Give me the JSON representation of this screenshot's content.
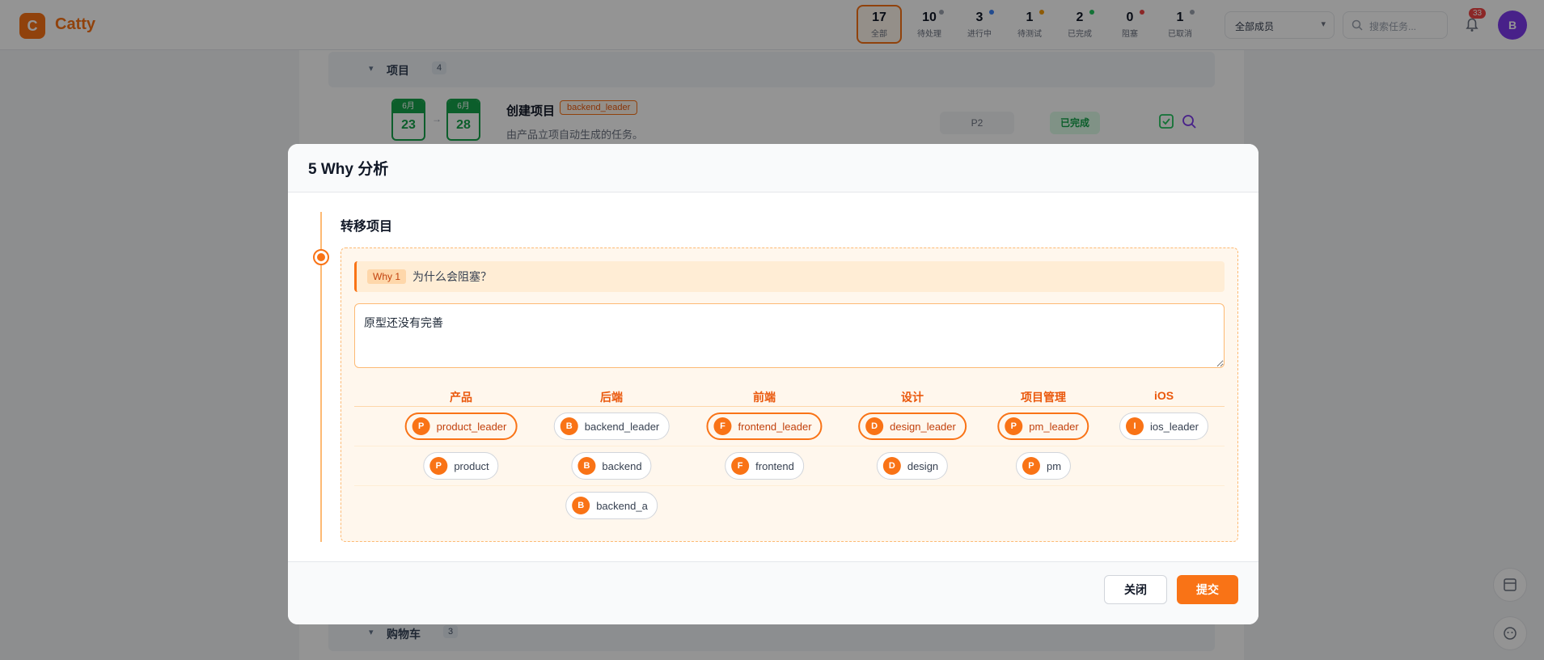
{
  "app": {
    "logo_letter": "C",
    "name": "Catty",
    "brand_color": "#f97316"
  },
  "header": {
    "stats": [
      {
        "count": "17",
        "label": "全部",
        "dot": ""
      },
      {
        "count": "10",
        "label": "待处理",
        "dot": "#9ca3af"
      },
      {
        "count": "3",
        "label": "进行中",
        "dot": "#3b82f6"
      },
      {
        "count": "1",
        "label": "待测试",
        "dot": "#f59e0b"
      },
      {
        "count": "2",
        "label": "已完成",
        "dot": "#22c55e"
      },
      {
        "count": "0",
        "label": "阻塞",
        "dot": "#ef4444"
      },
      {
        "count": "1",
        "label": "已取消",
        "dot": "#9ca3af"
      }
    ],
    "member_filter": "全部成员",
    "search_placeholder": "搜索任务...",
    "notification_count": "33",
    "user_initial": "B"
  },
  "background": {
    "groups": [
      {
        "name": "项目",
        "count": "4"
      },
      {
        "name": "购物车",
        "count": "3"
      }
    ],
    "task": {
      "start_month": "6月",
      "start_day": "23",
      "end_month": "6月",
      "end_day": "28",
      "title": "创建项目",
      "tag": "backend_leader",
      "description": "由产品立项自动生成的任务。",
      "priority": "P2",
      "status": "已完成"
    }
  },
  "modal": {
    "title": "5 Why 分析",
    "project_name": "转移项目",
    "why": {
      "badge": "Why 1",
      "question": "为什么会阻塞？",
      "answer": "原型还没有完善"
    },
    "columns": [
      {
        "name": "产品",
        "members": [
          {
            "initial": "P",
            "name": "product_leader",
            "selected": true
          },
          {
            "initial": "P",
            "name": "product",
            "selected": false
          }
        ]
      },
      {
        "name": "后端",
        "members": [
          {
            "initial": "B",
            "name": "backend_leader",
            "selected": false
          },
          {
            "initial": "B",
            "name": "backend",
            "selected": false
          },
          {
            "initial": "B",
            "name": "backend_a",
            "selected": false
          }
        ]
      },
      {
        "name": "前端",
        "members": [
          {
            "initial": "F",
            "name": "frontend_leader",
            "selected": true
          },
          {
            "initial": "F",
            "name": "frontend",
            "selected": false
          }
        ]
      },
      {
        "name": "设计",
        "members": [
          {
            "initial": "D",
            "name": "design_leader",
            "selected": true
          },
          {
            "initial": "D",
            "name": "design",
            "selected": false
          }
        ]
      },
      {
        "name": "项目管理",
        "members": [
          {
            "initial": "P",
            "name": "pm_leader",
            "selected": true
          },
          {
            "initial": "P",
            "name": "pm",
            "selected": false
          }
        ]
      },
      {
        "name": "iOS",
        "members": [
          {
            "initial": "I",
            "name": "ios_leader",
            "selected": false
          }
        ]
      }
    ],
    "close_label": "关闭",
    "submit_label": "提交"
  }
}
